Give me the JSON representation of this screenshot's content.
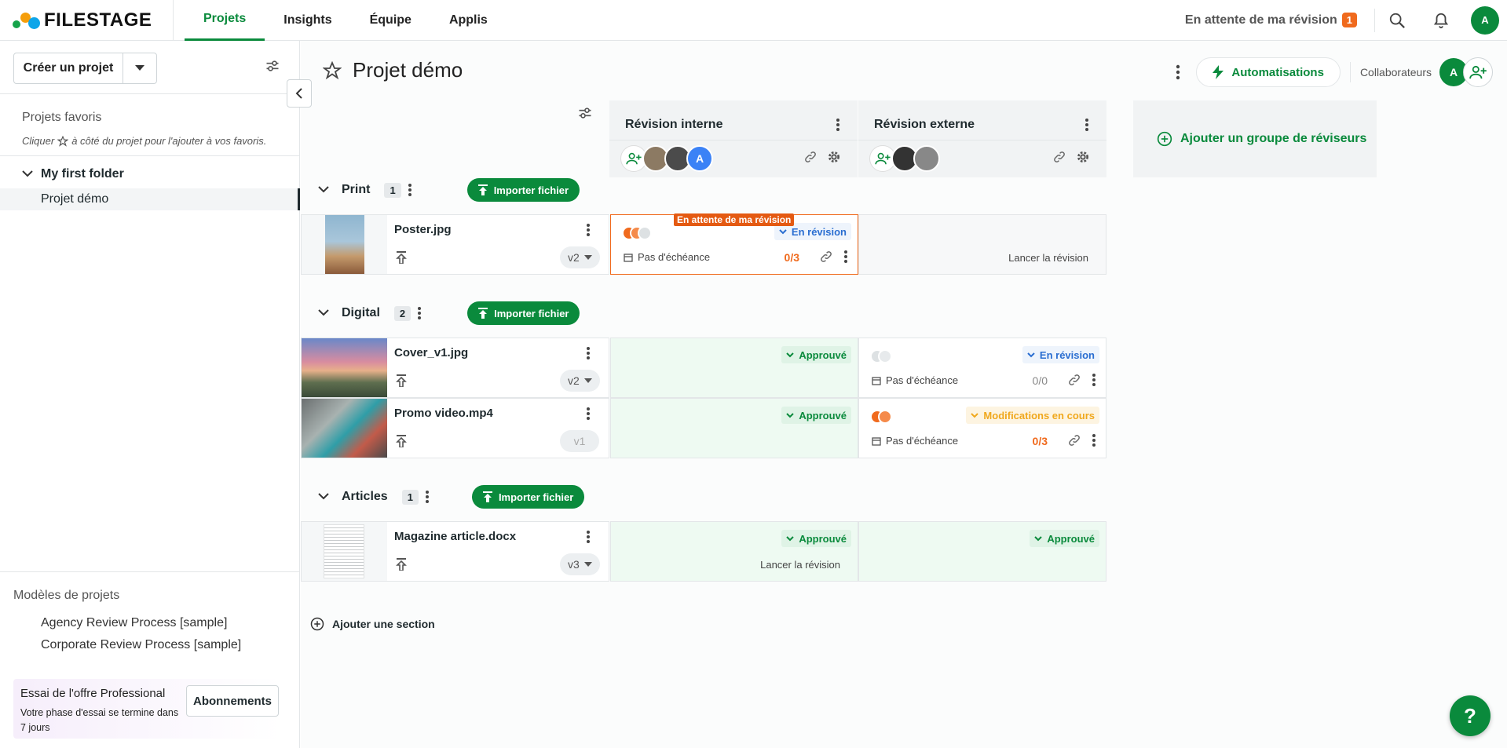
{
  "brand": {
    "name": "FILESTAGE"
  },
  "nav": [
    {
      "label": "Projets",
      "active": true
    },
    {
      "label": "Insights",
      "active": false
    },
    {
      "label": "Équipe",
      "active": false
    },
    {
      "label": "Applis",
      "active": false
    }
  ],
  "topbar": {
    "pending_label": "En attente de ma révision",
    "pending_count": "1",
    "avatar_initial": "A"
  },
  "sidebar": {
    "create_label": "Créer un projet",
    "favorites_title": "Projets favoris",
    "favorites_hint_before": "Cliquer",
    "favorites_hint_after": "à côté du projet pour l'ajouter à vos favoris.",
    "folder": "My first folder",
    "project": "Projet démo",
    "templates_title": "Modèles de projets",
    "templates": [
      "Agency Review Process [sample]",
      "Corporate Review Process [sample]"
    ],
    "trial_title": "Essai de l'offre Professional",
    "trial_text": "Votre phase d'essai se termine dans 7 jours",
    "trial_button": "Abonnements"
  },
  "project": {
    "title": "Projet démo",
    "automations_label": "Automatisations",
    "collaborators_label": "Collaborateurs",
    "collab_initial": "A"
  },
  "groups": [
    {
      "name": "Révision interne",
      "extra_initial": "A"
    },
    {
      "name": "Révision externe"
    }
  ],
  "add_group_label": "Ajouter un groupe de réviseurs",
  "import_label": "Importer fichier",
  "sections": [
    {
      "name": "Print",
      "count": "1"
    },
    {
      "name": "Digital",
      "count": "2"
    },
    {
      "name": "Articles",
      "count": "1"
    }
  ],
  "files": [
    {
      "name": "Poster.jpg",
      "version": "v2",
      "internal": {
        "tag": "En attente de ma révision",
        "status": "En révision",
        "due": "Pas d'échéance",
        "count": "0/3"
      },
      "external": {
        "launch": "Lancer la révision"
      }
    },
    {
      "name": "Cover_v1.jpg",
      "version": "v2",
      "internal": {
        "status": "Approuvé"
      },
      "external": {
        "status": "En révision",
        "due": "Pas d'échéance",
        "count": "0/0"
      }
    },
    {
      "name": "Promo video.mp4",
      "version": "v1",
      "internal": {
        "status": "Approuvé"
      },
      "external": {
        "status": "Modifications en cours",
        "due": "Pas d'échéance",
        "count": "0/3"
      }
    },
    {
      "name": "Magazine article.docx",
      "version": "v3",
      "internal": {
        "status": "Approuvé",
        "launch": "Lancer la révision"
      },
      "external": {
        "status": "Approuvé"
      }
    }
  ],
  "add_section_label": "Ajouter une section",
  "help_label": "?",
  "colors": {
    "accent": "#0a8a3c",
    "pending": "#f06a1d",
    "review": "#2a6ed1",
    "changes": "#f0a81d"
  }
}
